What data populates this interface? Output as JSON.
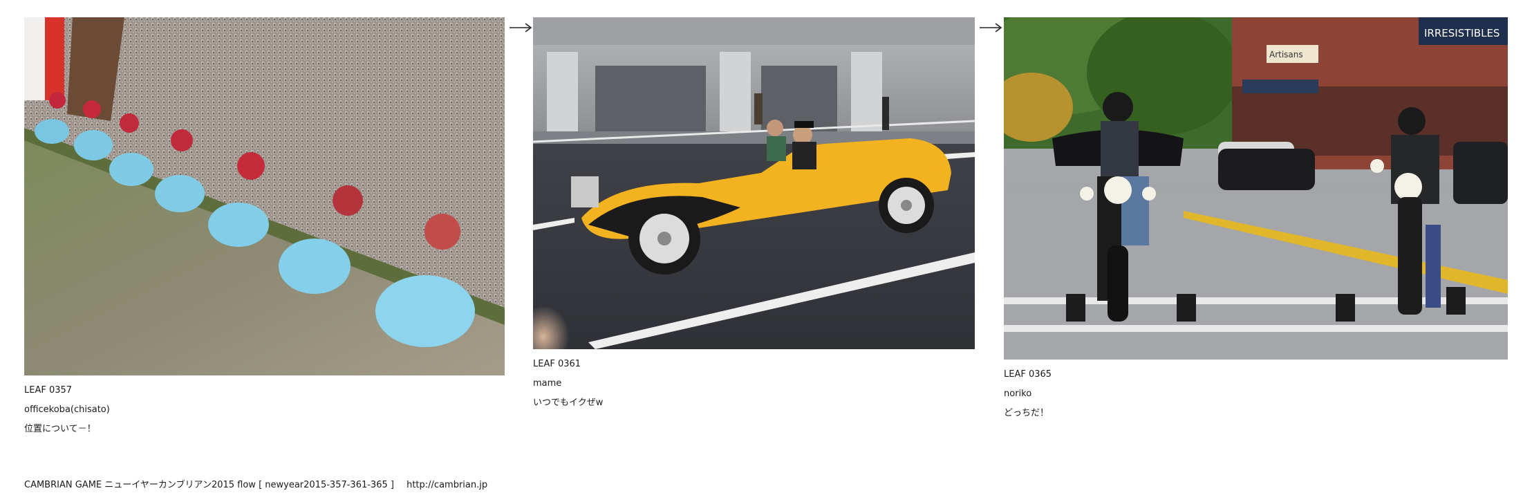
{
  "leaves": [
    {
      "number": "LEAF 0357",
      "author": "officekoba(chisato)",
      "comment": "位置について－！",
      "photo_icon": "ceramic-birds-photo"
    },
    {
      "number": "LEAF 0361",
      "author": "mame",
      "comment": "いつでもイクぜw",
      "photo_icon": "yellow-vintage-car-photo"
    },
    {
      "number": "LEAF 0365",
      "author": "noriko",
      "comment": "どっちだ！",
      "photo_icon": "motorcycle-riders-photo",
      "sign_text_1": "IRRESISTIBLES",
      "sign_text_2": "Artisans"
    }
  ],
  "arrow_glyph": "→",
  "footer": {
    "title": "CAMBRIAN GAME ニューイヤーカンブリアン2015 flow [ newyear2015-357-361-365 ]",
    "url": "http://cambrian.jp"
  }
}
